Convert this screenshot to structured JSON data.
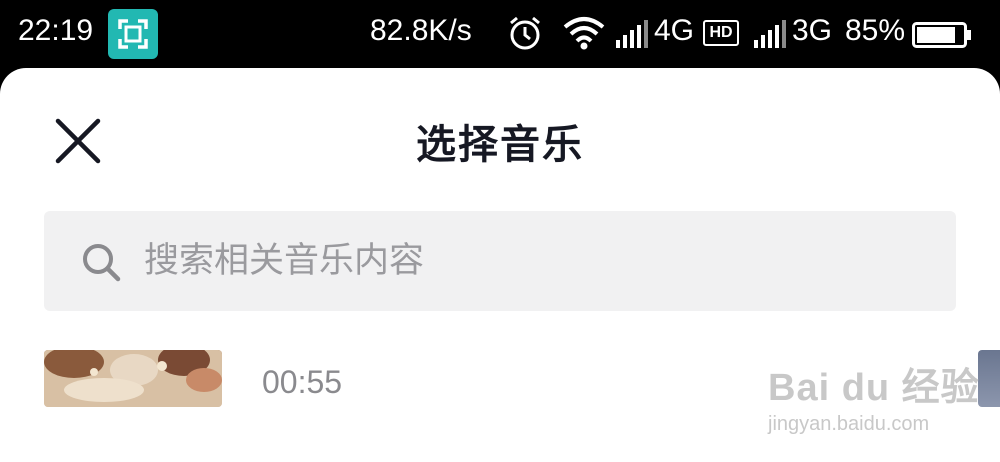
{
  "status_bar": {
    "time": "22:19",
    "network_speed": "82.8K/s",
    "network_1": "4G",
    "hd_badge": "HD",
    "network_2": "3G",
    "battery": "85%",
    "battery_level": 0.85,
    "accent_color": "#22b8b2"
  },
  "sheet": {
    "title": "选择音乐",
    "close_icon": "close-icon"
  },
  "search": {
    "placeholder": "搜索相关音乐内容",
    "icon": "search-icon"
  },
  "music_list": [
    {
      "duration": "00:55"
    }
  ],
  "watermark": {
    "line1": "Bai  du 经验",
    "line2": "jingyan.baidu.com"
  }
}
